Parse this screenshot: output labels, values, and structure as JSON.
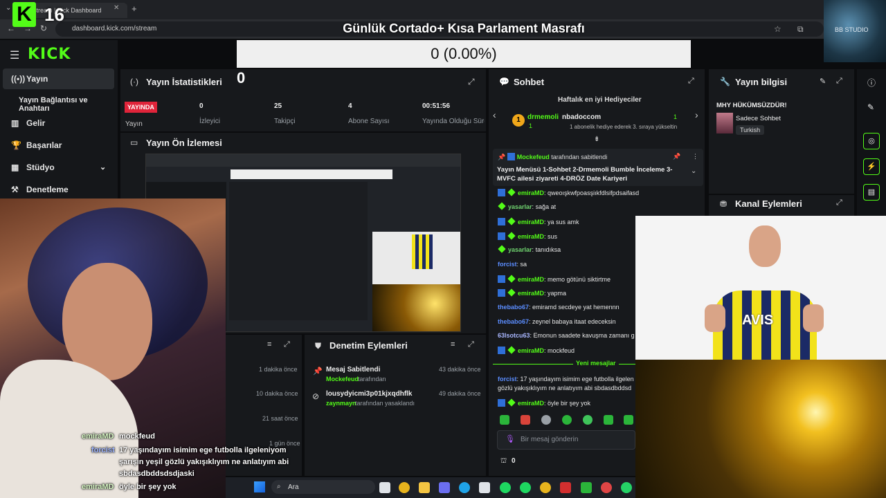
{
  "browser": {
    "tab_title": "stream | Kick Dashboard",
    "url": "dashboard.kick.com/stream",
    "overlay_title": "Günlük Cortado+ Kısa Parlament Masrafı",
    "kick_count": "16",
    "studio_label": "BB STUDIO"
  },
  "counter": {
    "text": "0 (0.00%)",
    "side_number": "0"
  },
  "sidebar": {
    "logo": "KICK",
    "items": [
      {
        "label": "Yayın"
      },
      {
        "label": "Yayın Bağlantısı ve Anahtarı"
      },
      {
        "label": "Gelir"
      },
      {
        "label": "Başarılar"
      },
      {
        "label": "Stüdyo"
      },
      {
        "label": "Denetleme"
      }
    ]
  },
  "stats": {
    "title": "Yayın İstatistikleri",
    "live_badge": "YAYINDA",
    "live_label": "Yayın",
    "items": [
      {
        "value": "0",
        "label": "İzleyici"
      },
      {
        "value": "25",
        "label": "Takipçi"
      },
      {
        "value": "4",
        "label": "Abone Sayısı"
      },
      {
        "value": "00:51:56",
        "label": "Yayında Olduğu Süre"
      }
    ]
  },
  "preview": {
    "title": "Yayın Ön İzlemesi"
  },
  "activity": {
    "times": [
      "1 dakika önce",
      "10 dakika önce",
      "21 saat önce",
      "1 gün önce"
    ]
  },
  "moderation": {
    "title": "Denetim Eylemleri",
    "items": [
      {
        "title": "Mesaj Sabitlendi",
        "user": "Mockefeud",
        "suffix": "tarafından",
        "time": "43 dakika önce"
      },
      {
        "title": "lousydyicmi3p01kjxqdhflk",
        "user": "zaynmayn",
        "suffix": "tarafından yasaklandı",
        "time": "49 dakika önce"
      }
    ]
  },
  "chat": {
    "title": "Sohbet",
    "gifters_title": "Haftalık en iyi Hediyeciler",
    "gifter1": {
      "name": "drmemoli",
      "count": "1"
    },
    "gifter2": {
      "name": "nbadoccom",
      "count": "1",
      "note": "1 abonelik hediye ederek 3. sıraya yükseltin"
    },
    "pinned_by": "Mockefeud",
    "pinned_suffix": "tarafından sabitlendi",
    "pinned_text": "Yayın Menüsü 1-Sohbet 2-Drmemoli Bumble İnceleme 3-MVFC ailesi ziyareti 4-DRÖZ Date Kariyeri",
    "messages": [
      {
        "user": "emiraMD",
        "text": "qweoışkwfpoasşiıkfdlsifpdsaifasd"
      },
      {
        "user": "yasarlar",
        "text": "sağa at"
      },
      {
        "user": "emiraMD",
        "text": "ya sus amk"
      },
      {
        "user": "emiraMD",
        "text": "sus"
      },
      {
        "user": "yasarlar",
        "text": "tanıdıksa"
      },
      {
        "user": "forcist",
        "text": "sa"
      },
      {
        "user": "emiraMD",
        "text": "memo götünü siktirtme"
      },
      {
        "user": "emiraMD",
        "text": "yapma"
      },
      {
        "user": "thebabo67",
        "text": "emiramd secdeye yat hemennn"
      },
      {
        "user": "thebabo67",
        "text": "zeynel babaya itaat edeceksin"
      },
      {
        "user": "63lsotcu63",
        "text": "Emonun saadete kavuşma zamanı g"
      },
      {
        "user": "emiraMD",
        "text": "mockfeud"
      }
    ],
    "new_messages": "Yeni mesajlar",
    "after": [
      {
        "user": "forcist",
        "text": "17 yaşındayım isimim ege futbolla ilgelen",
        "text2": "gözlü yakışıklıyım ne anlatıyım abi sbdasdbddsd"
      },
      {
        "user": "emiraMD",
        "text": "öyle bir şey yok"
      }
    ],
    "input_placeholder": "Bir mesaj gönderin",
    "viewer_count": "0"
  },
  "info": {
    "title": "Yayın bilgisi",
    "stream_title": "MHY HÜKÜMSÜZDÜR!",
    "mode": "Sadece Sohbet",
    "language": "Turkish",
    "actions_title": "Kanal Eylemleri"
  },
  "overlay_chat": [
    {
      "user": "emiraMD",
      "text": "mockfeud"
    },
    {
      "user": "forcist",
      "text": "17 yaşındayım isimim ege futbolla ilgeleniyom"
    },
    {
      "user": "",
      "text": "şarışın yeşil gözlü yakışıklıyım ne anlatıyım abi"
    },
    {
      "user": "",
      "text": "sbdasdbddsdsdjaski"
    },
    {
      "user": "emiraMD",
      "text": "öyle bir şey yok"
    }
  ],
  "jersey_text": "AVIS",
  "taskbar": {
    "search": "Ara"
  },
  "colors": {
    "kick_green": "#53fc18",
    "live_red": "#e0243a",
    "panel": "#17191c"
  }
}
